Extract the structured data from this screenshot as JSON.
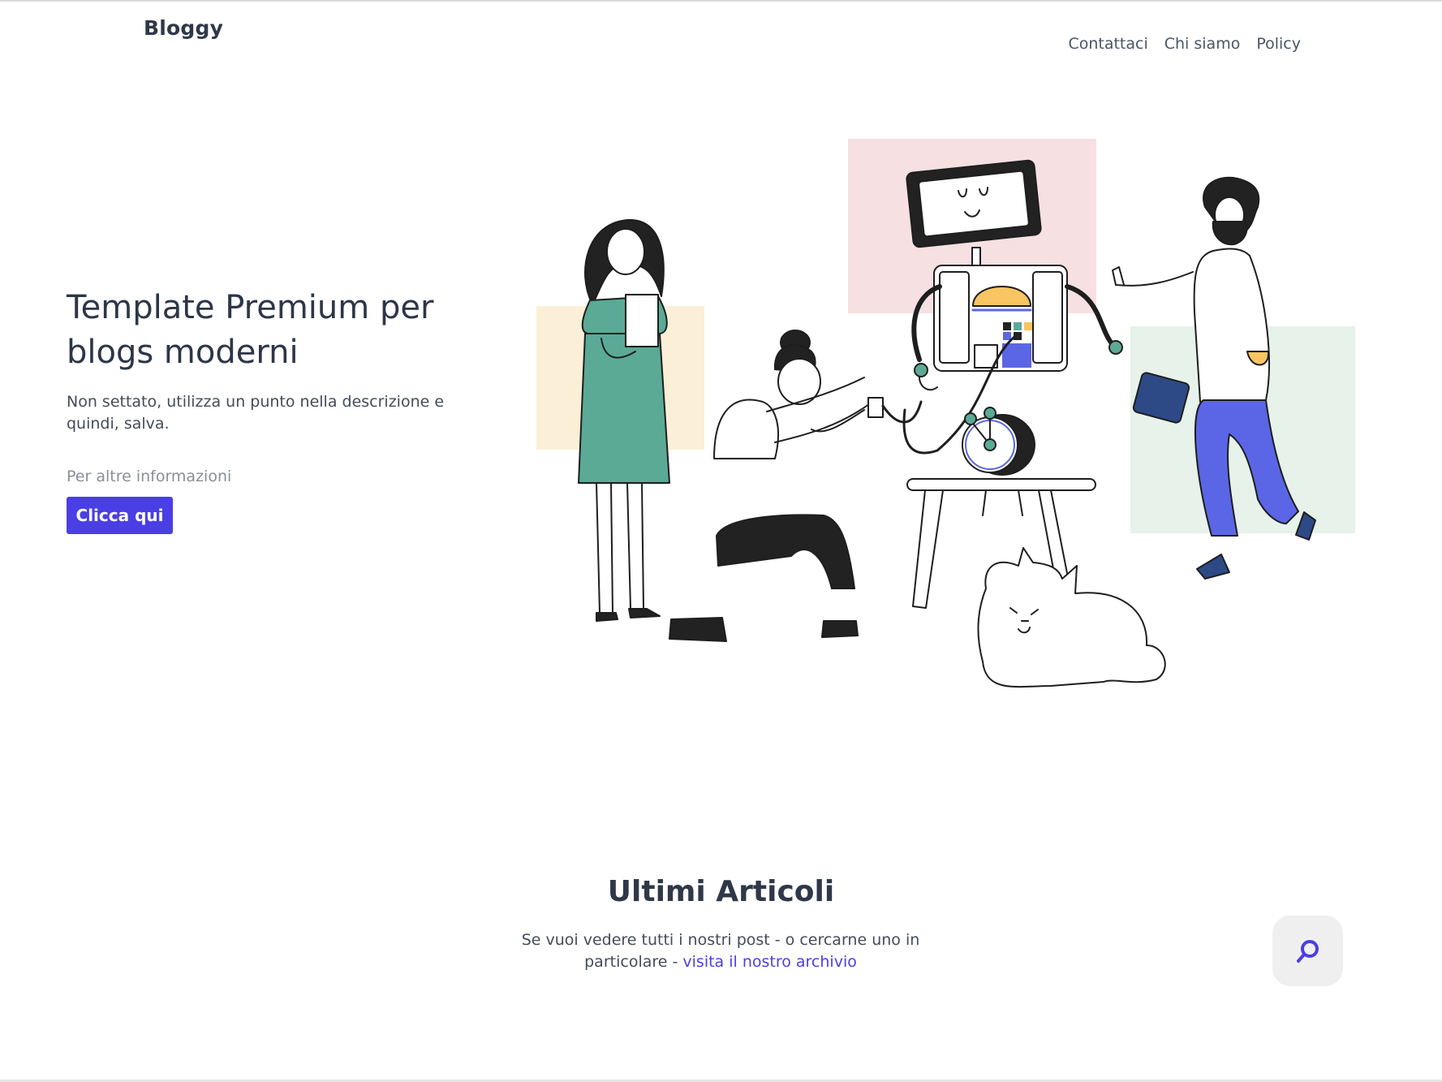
{
  "header": {
    "brand": "Bloggy",
    "nav": [
      "Contattaci",
      "Chi siamo",
      "Policy"
    ]
  },
  "hero": {
    "title": "Template Premium per blogs moderni",
    "description": "Non settato, utilizza un punto nella descrizione e quindi, salva.",
    "more_info": "Per altre informazioni",
    "cta_label": "Clicca qui"
  },
  "articles": {
    "title": "Ultimi Articoli",
    "text": "Se vuoi vedere tutti i nostri post - o cercarne uno in particolare - ",
    "link_label": "visita il nostro archivio"
  },
  "colors": {
    "accent": "#4a3fe4",
    "text_dark": "#2d3648",
    "teal": "#5aaa96",
    "blue": "#5b66e6",
    "pink_bg": "#f7e0e1",
    "yellow_bg": "#fbefd8",
    "green_bg": "#e6f2ea"
  },
  "icons": {
    "search": "search-icon"
  }
}
